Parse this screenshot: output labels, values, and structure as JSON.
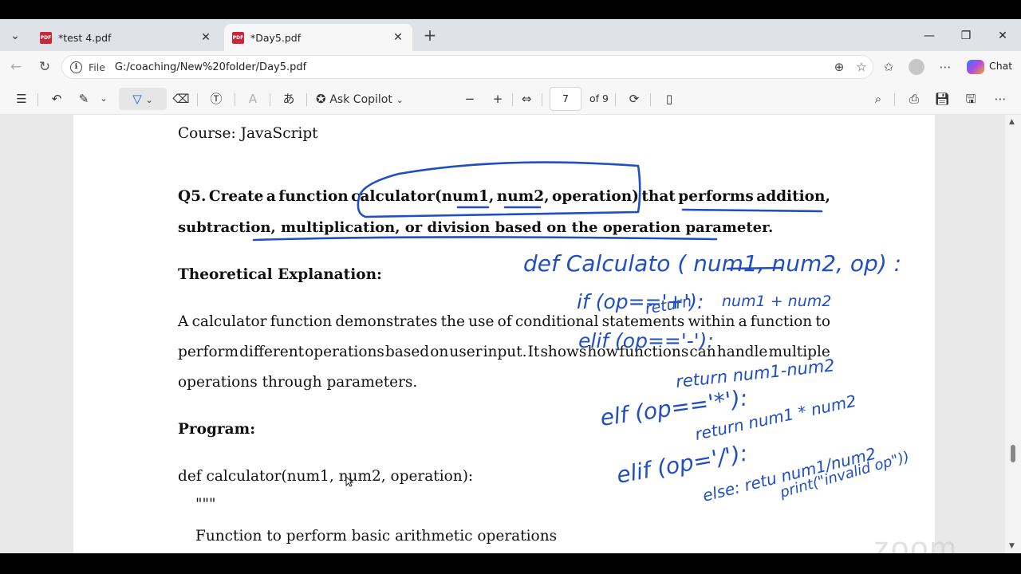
{
  "tabs": [
    {
      "label": "*test 4.pdf",
      "icon": "pdf-icon"
    },
    {
      "label": "*Day5.pdf",
      "icon": "pdf-icon"
    }
  ],
  "address": {
    "scheme": "File",
    "url": "G:/coaching/New%20folder/Day5.pdf"
  },
  "chat_label": "Chat",
  "toolbar": {
    "ask_copilot": "Ask Copilot",
    "page_number": "7",
    "page_total": "of 9"
  },
  "document": {
    "course_line": "Course: JavaScript",
    "question_line1_parts": [
      "Q5.",
      "Create",
      "a",
      "function",
      "calculator(num1,",
      "num2,",
      "operation)",
      "that",
      "performs",
      "addition,"
    ],
    "question_line2": "subtraction, multiplication, or division based on the operation parameter.",
    "theory_heading": "Theoretical Explanation:",
    "theory_line1_parts": [
      "A",
      "calculator",
      "function",
      "demonstrates",
      "the",
      "use",
      "of",
      "conditional",
      "statements",
      "within",
      "a",
      "function",
      "to"
    ],
    "theory_line2_parts": [
      "perform",
      "different",
      "operations",
      "based",
      "on",
      "user",
      "input.",
      "It",
      "shows",
      "how",
      "functions",
      "can",
      "handle",
      "multiple"
    ],
    "theory_line3": "operations through parameters.",
    "program_heading": "Program:",
    "code_line1": "def calculator(num1, num2, operation):",
    "code_line2": "\"\"\"",
    "code_line3": "Function to perform basic arithmetic operations"
  },
  "watermark": "zoom",
  "colors": {
    "ink": "#1f4fc2",
    "tab_bar": "#dfe3e8",
    "page": "#ffffff"
  }
}
